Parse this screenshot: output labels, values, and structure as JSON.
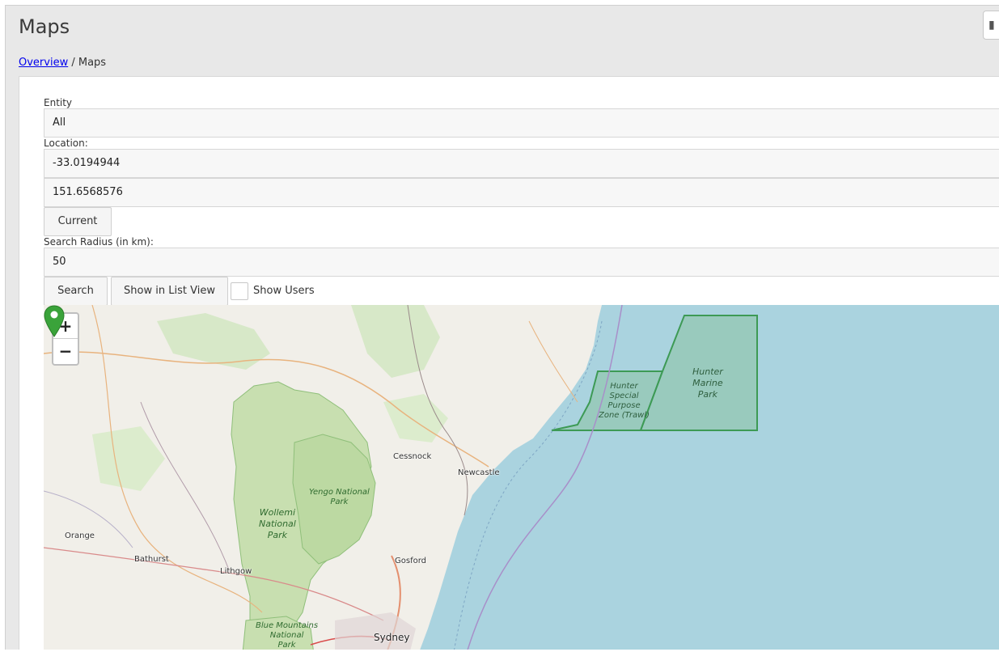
{
  "page": {
    "title": "Maps"
  },
  "breadcrumb": {
    "parent": "Overview",
    "separator": " / ",
    "current": "Maps"
  },
  "form": {
    "entity": {
      "label": "Entity",
      "value": "All"
    },
    "location": {
      "label": "Location:",
      "latitude": "-33.0194944",
      "longitude": "151.6568576"
    },
    "current_button": "Current",
    "radius": {
      "label": "Search Radius (in km):",
      "value": "50"
    },
    "search_button": "Search",
    "list_view_button": "Show in List View",
    "show_users": {
      "label": "Show Users",
      "checked": false
    }
  },
  "map": {
    "zoom_in": "+",
    "zoom_out": "−",
    "places": {
      "cessnock": "Cessnock",
      "newcastle": "Newcastle",
      "orange": "Orange",
      "bathurst": "Bathurst",
      "lithgow": "Lithgow",
      "gosford": "Gosford",
      "sydney": "Sydney"
    },
    "parks": {
      "wollemi": [
        "Wollemi",
        "National",
        "Park"
      ],
      "yengo": [
        "Yengo National",
        "Park"
      ],
      "blue_mountains": [
        "Blue Mountains",
        "National",
        "Park"
      ]
    },
    "marine": {
      "hunter_special": [
        "Hunter",
        "Special",
        "Purpose",
        "Zone (Trawl)"
      ],
      "hunter_marine": [
        "Hunter",
        "Marine",
        "Park"
      ]
    },
    "marker_color": "#3aa33a",
    "sea_color": "#aad3df",
    "land_color": "#f1efe9",
    "park_color": "#c8dfb0"
  }
}
